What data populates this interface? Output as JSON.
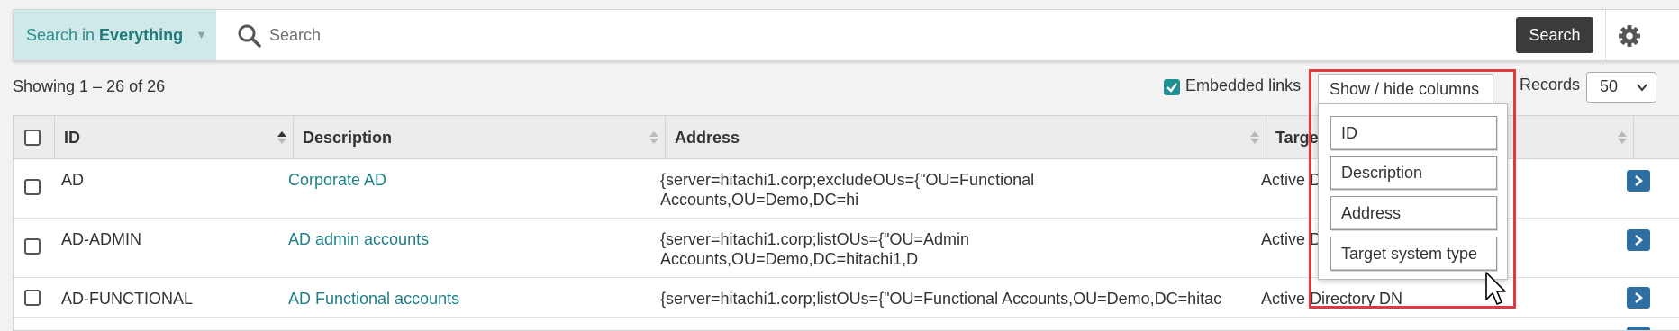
{
  "search": {
    "scope_prefix": "Search in",
    "scope_value": "Everything",
    "placeholder": "Search",
    "button_label": "Search"
  },
  "toolbar": {
    "showing": "Showing 1 – 26 of 26",
    "embedded_links_label": "Embedded links",
    "embedded_links_checked": true,
    "show_hide_label": "Show / hide columns",
    "records_label": "Records",
    "records_value": "50"
  },
  "table": {
    "columns": [
      "ID",
      "Description",
      "Address",
      "Target s"
    ],
    "rows": [
      {
        "id": "AD",
        "description": "Corporate AD",
        "address_line1": "{server=hitachi1.corp;excludeOUs={\"OU=Functional",
        "address_line2": "Accounts,OU=Demo,DC=hi",
        "target": "Active D"
      },
      {
        "id": "AD-ADMIN",
        "description": "AD admin accounts",
        "address_line1": "{server=hitachi1.corp;listOUs={\"OU=Admin",
        "address_line2": "Accounts,OU=Demo,DC=hitachi1,D",
        "target": "Active D"
      },
      {
        "id": "AD-FUNCTIONAL",
        "description": "AD Functional accounts",
        "address_line1": "{server=hitachi1.corp;listOUs={\"OU=Functional Accounts,OU=Demo,DC=hitac",
        "address_line2": "",
        "target": "Active Directory DN"
      }
    ]
  },
  "column_menu": {
    "items": [
      "ID",
      "Description",
      "Address",
      "Target system type"
    ]
  },
  "colors": {
    "accent": "#1f8f8f",
    "highlight": "#e0393e",
    "go_button": "#2d6ea3"
  }
}
